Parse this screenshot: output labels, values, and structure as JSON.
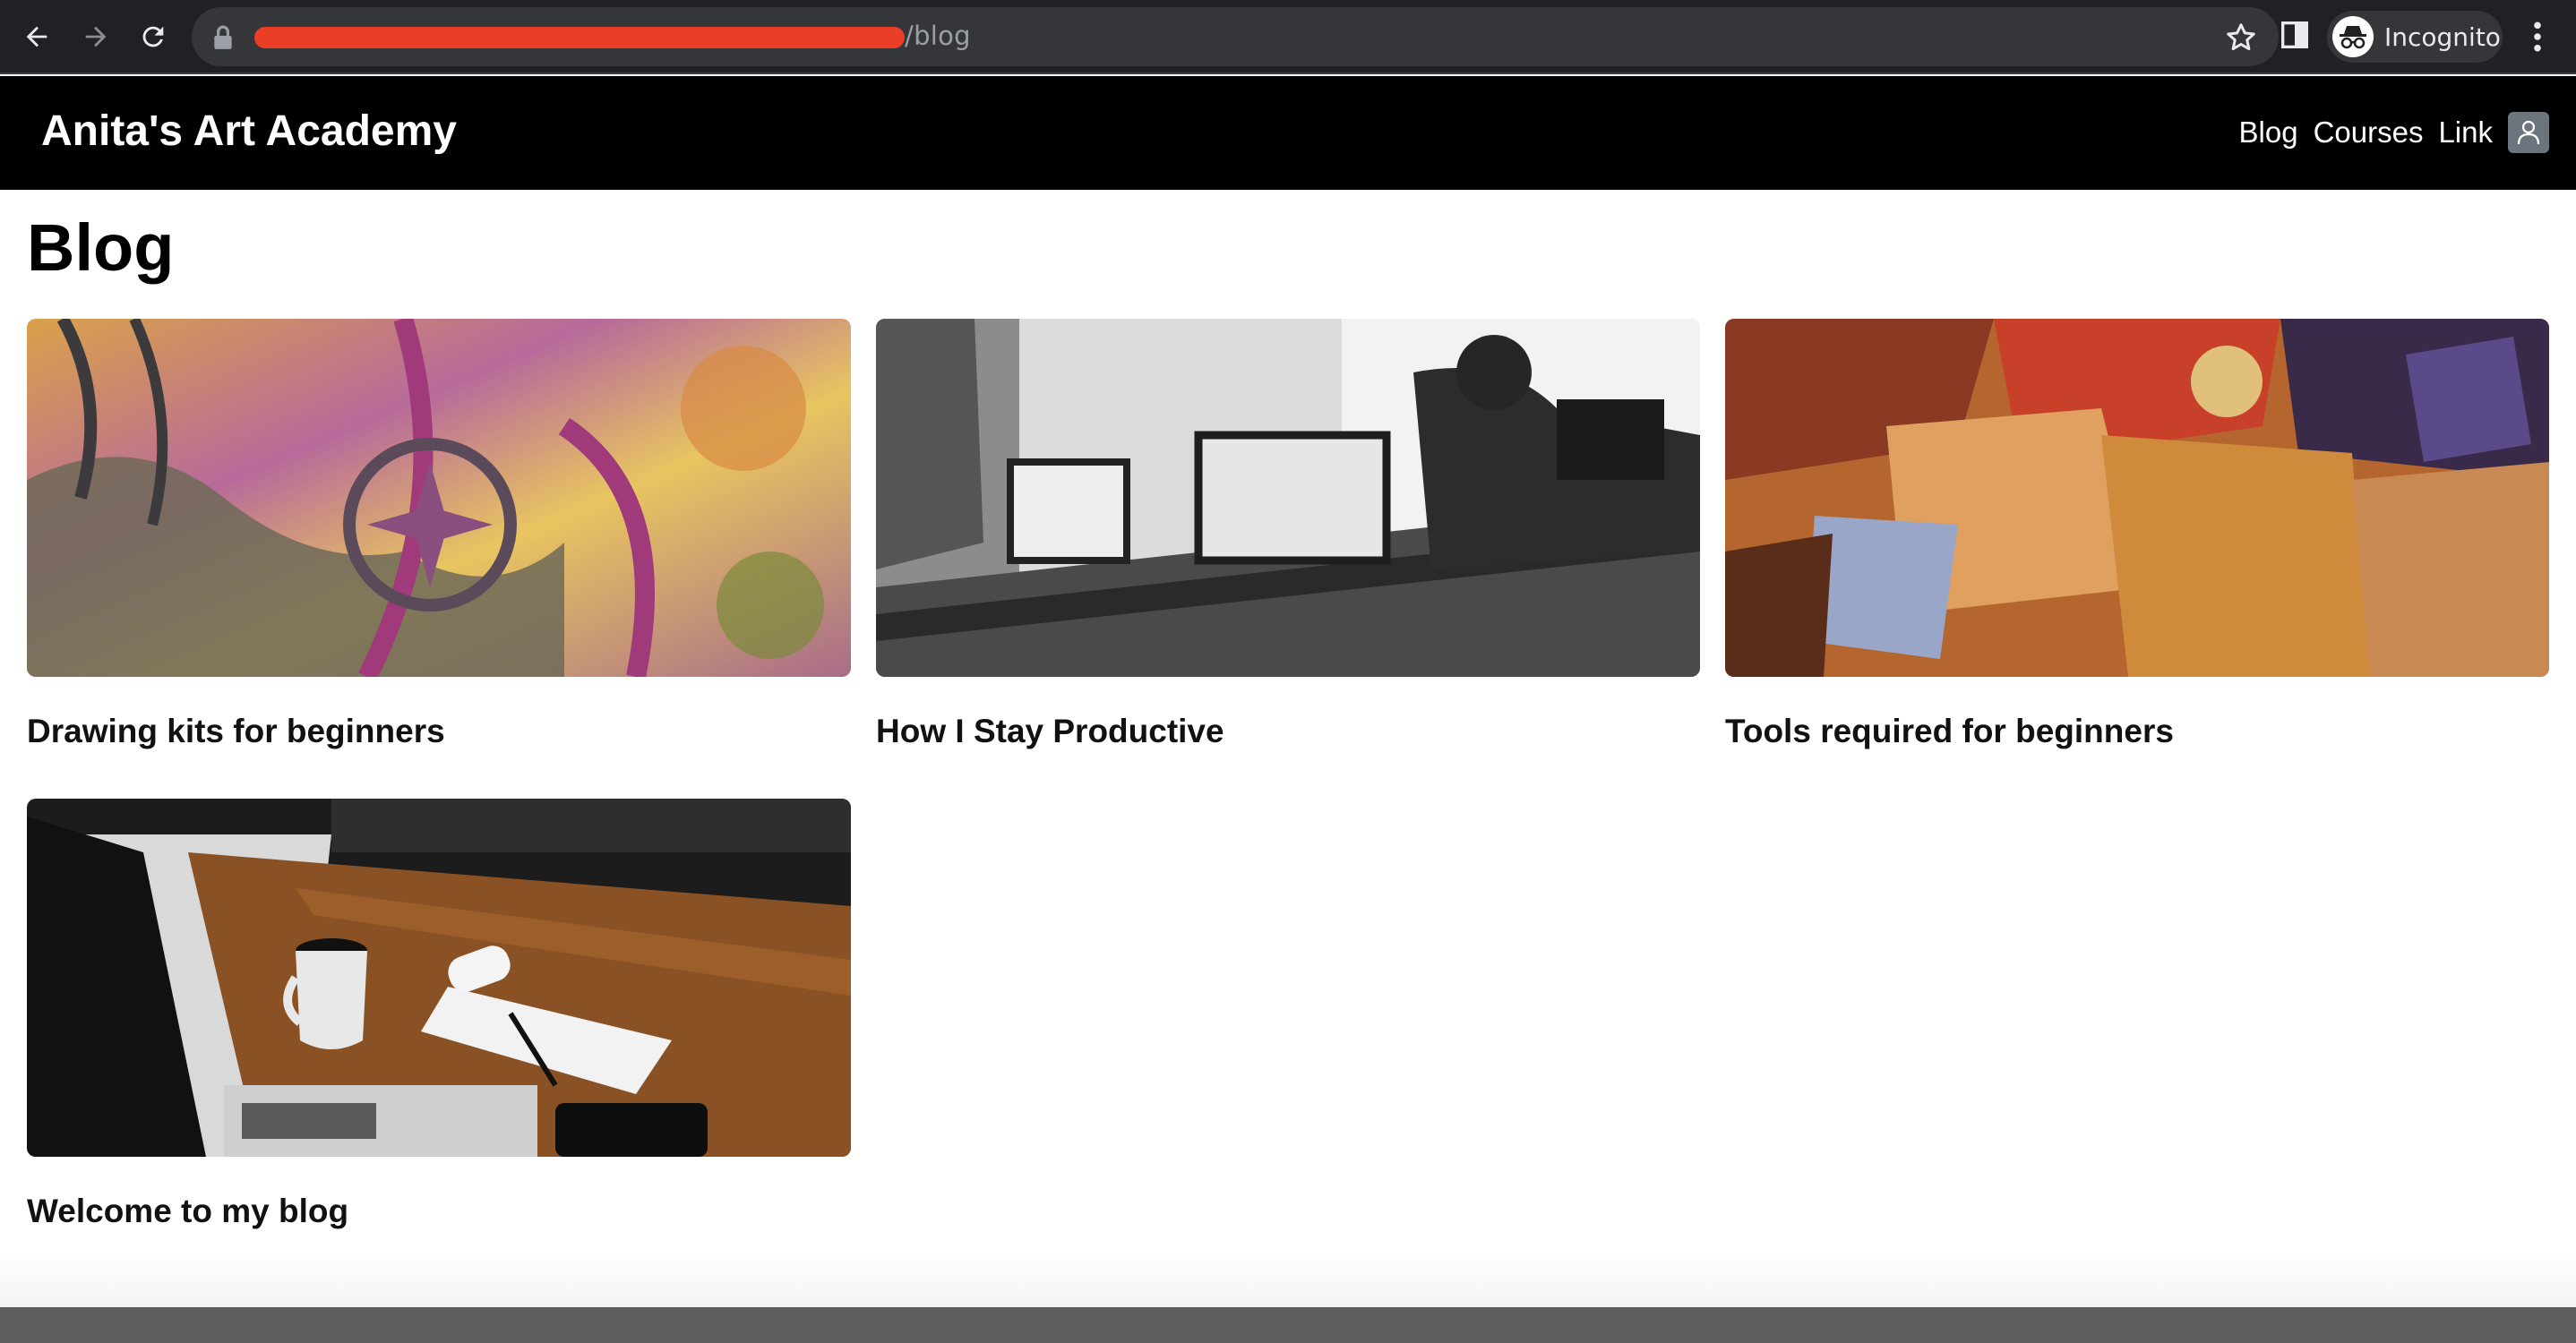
{
  "browser": {
    "url_suffix": "/blog",
    "profile_label": "Incognito"
  },
  "site": {
    "brand": "Anita's Art Academy",
    "nav": [
      "Blog",
      "Courses",
      "Link"
    ]
  },
  "page": {
    "title": "Blog"
  },
  "posts": [
    {
      "title": "Drawing kits for beginners",
      "image": "abstract-mosaic-art"
    },
    {
      "title": "How I Stay Productive",
      "image": "people-at-laptops-bw"
    },
    {
      "title": "Tools required for beginners",
      "image": "oil-paint-palette"
    },
    {
      "title": "Welcome to my blog",
      "image": "laptop-coffee-desk"
    }
  ],
  "colors": {
    "chrome_bg": "#202124",
    "omnibox_bg": "#35363a",
    "navbar_bg": "#000000",
    "redaction": "#ea3e26"
  }
}
